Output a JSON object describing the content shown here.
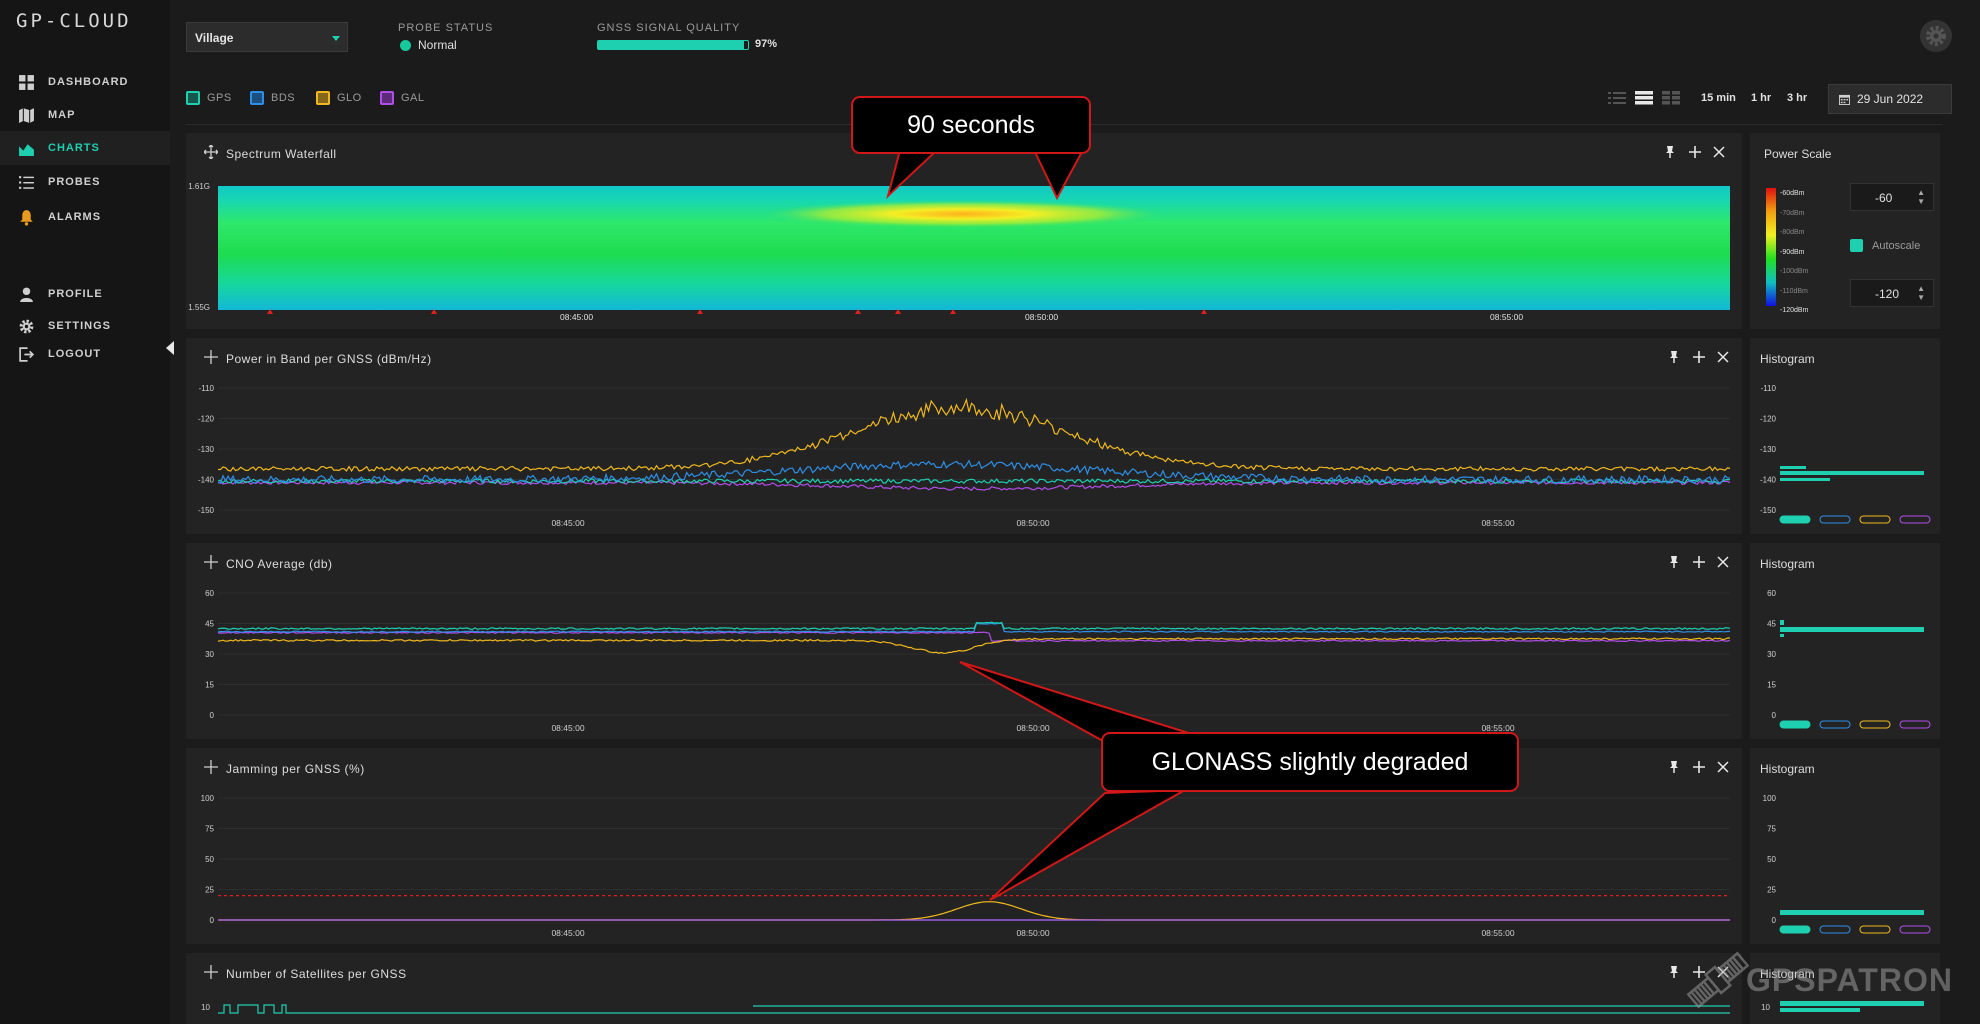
{
  "app": {
    "title": "GP-CLOUD"
  },
  "sidebar": {
    "items": [
      {
        "label": "DASHBOARD",
        "icon": "grid-icon"
      },
      {
        "label": "MAP",
        "icon": "map-icon"
      },
      {
        "label": "CHARTS",
        "icon": "area-chart-icon",
        "active": true
      },
      {
        "label": "PROBES",
        "icon": "list-icon"
      },
      {
        "label": "ALARMS",
        "icon": "bell-icon"
      }
    ],
    "account": [
      {
        "label": "PROFILE",
        "icon": "user-icon"
      },
      {
        "label": "SETTINGS",
        "icon": "gear-icon"
      },
      {
        "label": "LOGOUT",
        "icon": "logout-icon"
      }
    ]
  },
  "header": {
    "location": "Village",
    "probe_status_title": "PROBE STATUS",
    "probe_status": "Normal",
    "quality_title": "GNSS SIGNAL QUALITY",
    "quality_value": "97%",
    "quality_fraction": 0.97
  },
  "legend": [
    {
      "label": "GPS",
      "color": "#1ecfb0"
    },
    {
      "label": "BDS",
      "color": "#2e8fe6"
    },
    {
      "label": "GLO",
      "color": "#f0b81e"
    },
    {
      "label": "GAL",
      "color": "#b04ee8"
    }
  ],
  "toolbar": {
    "ranges": [
      "15 min",
      "1 hr",
      "3 hr"
    ],
    "date": "29 Jun 2022"
  },
  "colors": {
    "gps": "#1ecfb0",
    "bds": "#2e8fe6",
    "glo": "#f0b81e",
    "gal": "#b04ee8",
    "accent": "#1ecfb0",
    "callout_border": "#d01818"
  },
  "panels": {
    "waterfall": {
      "title": "Spectrum Waterfall",
      "y_top": "1.61G",
      "y_bottom": "1.55G",
      "x_ticks": [
        "08:45:00",
        "08:50:00",
        "08:55:00"
      ]
    },
    "power": {
      "title": "Power in Band per GNSS (dBm/Hz)",
      "y_ticks": [
        "-110",
        "-120",
        "-130",
        "-140",
        "-150"
      ],
      "x_ticks": [
        "08:45:00",
        "08:50:00",
        "08:55:00"
      ]
    },
    "cno": {
      "title": "CNO Average (db)",
      "y_ticks": [
        "60",
        "45",
        "30",
        "15",
        "0"
      ],
      "x_ticks": [
        "08:45:00",
        "08:50:00",
        "08:55:00"
      ]
    },
    "jamming": {
      "title": "Jamming per GNSS (%)",
      "y_ticks": [
        "100",
        "75",
        "50",
        "25",
        "0"
      ],
      "x_ticks": [
        "08:45:00",
        "08:50:00",
        "08:55:00"
      ]
    },
    "satellites": {
      "title": "Number of Satellites per GNSS",
      "y_ticks": [
        "10"
      ]
    }
  },
  "power_scale": {
    "title": "Power Scale",
    "labels": [
      "-60dBm",
      "-70dBm",
      "-80dBm",
      "-90dBm",
      "-100dBm",
      "-110dBm",
      "-120dBm"
    ],
    "max": "-60",
    "min": "-120",
    "autoscale_label": "Autoscale"
  },
  "histograms": {
    "title": "Histogram",
    "power_ticks": [
      "-110",
      "-120",
      "-130",
      "-140",
      "-150"
    ],
    "cno_ticks": [
      "60",
      "45",
      "30",
      "15",
      "0"
    ],
    "jam_ticks": [
      "100",
      "75",
      "50",
      "25",
      "0"
    ],
    "sat_ticks": [
      "10"
    ]
  },
  "callouts": {
    "top": "90 seconds",
    "middle": "GLONASS slightly degraded"
  },
  "watermark": "GPSPATRON"
}
